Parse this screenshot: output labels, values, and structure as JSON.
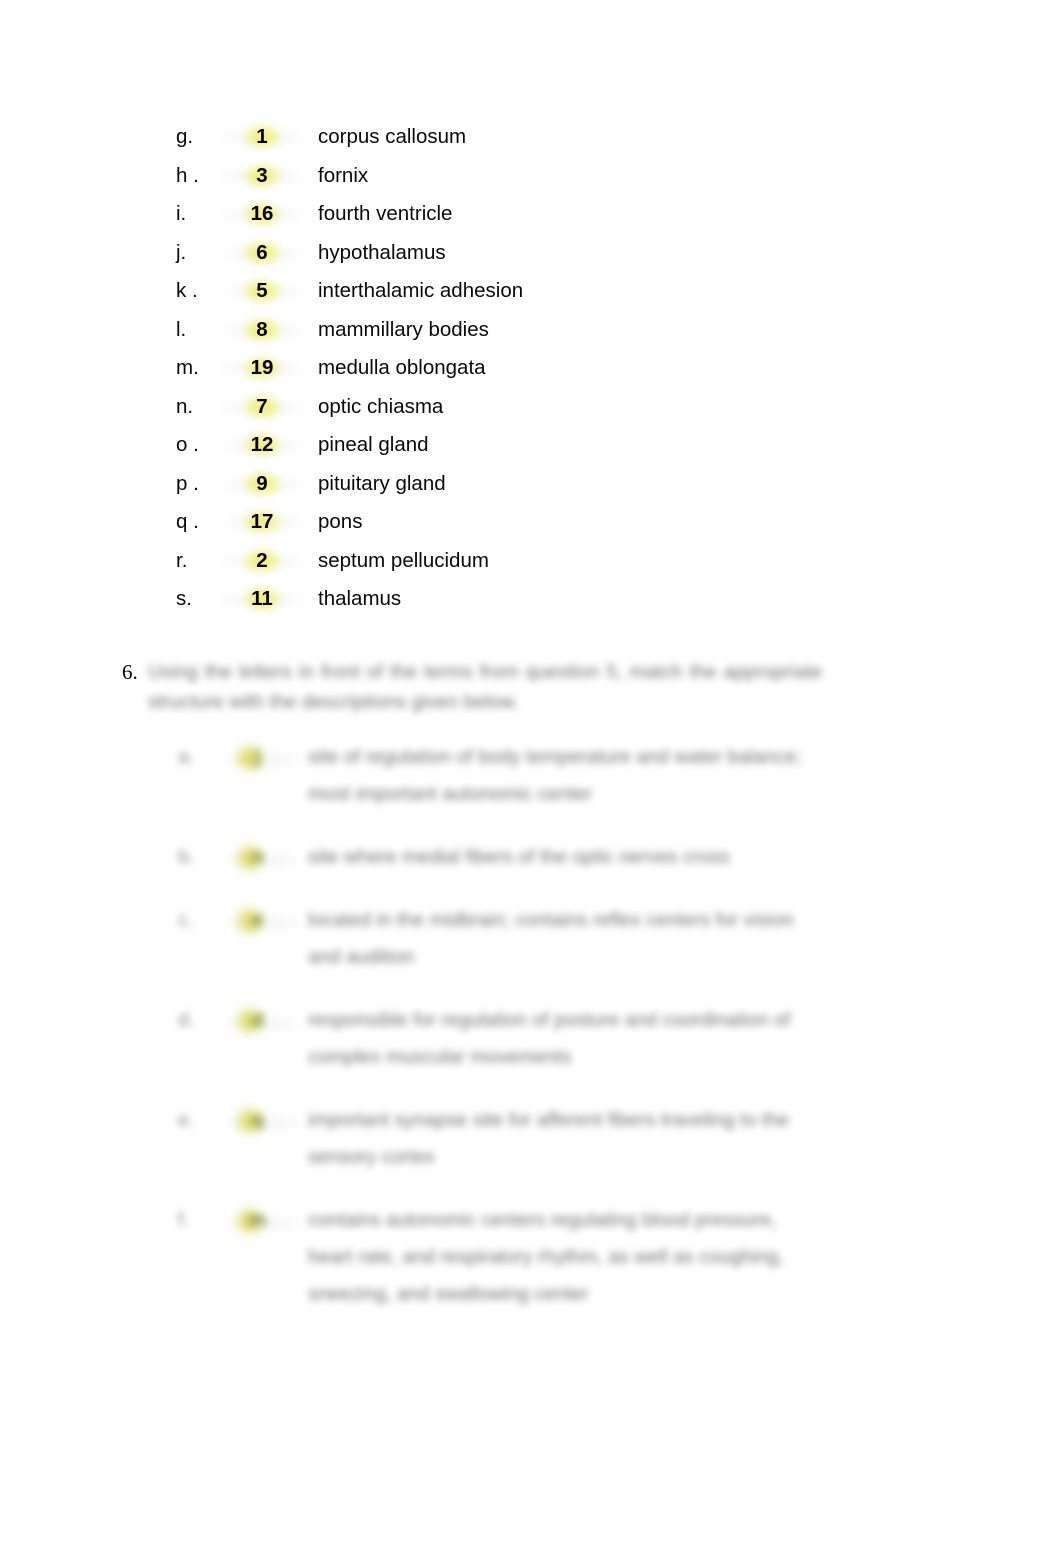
{
  "document": {
    "background_color": "#ffffff",
    "text_color": "#000000",
    "highlight_color": "#f0ee6e"
  },
  "matching_list": {
    "rows": [
      {
        "letter": "g.",
        "answer": "1",
        "term": "corpus callosum"
      },
      {
        "letter": "h .",
        "answer": "3",
        "term": "fornix"
      },
      {
        "letter": "i.",
        "answer": "16",
        "term": "fourth ventricle"
      },
      {
        "letter": "j.",
        "answer": "6",
        "term": "hypothalamus"
      },
      {
        "letter": "k .",
        "answer": "5",
        "term": "interthalamic adhesion"
      },
      {
        "letter": "l.",
        "answer": "8",
        "term": "mammillary bodies"
      },
      {
        "letter": "m.",
        "answer": "19",
        "term": "medulla oblongata"
      },
      {
        "letter": "n.",
        "answer": "7",
        "term": "optic chiasma"
      },
      {
        "letter": "o .",
        "answer": "12",
        "term": "pineal gland"
      },
      {
        "letter": "p .",
        "answer": "9",
        "term": "pituitary gland"
      },
      {
        "letter": "q .",
        "answer": "17",
        "term": "pons"
      },
      {
        "letter": "r.",
        "answer": "2",
        "term": "septum pellucidum"
      },
      {
        "letter": "s.",
        "answer": "11",
        "term": "thalamus"
      }
    ]
  },
  "question_6": {
    "number": "6.",
    "stem": "Using the letters in front of the terms from question 5, match the appropriate structure with the descriptions given below.",
    "items": [
      {
        "letter": "a.",
        "answer": "j",
        "description": "site of regulation of body temperature and water balance; most important autonomic center"
      },
      {
        "letter": "b.",
        "answer": "n",
        "description": "site where medial fibers of the optic nerves cross"
      },
      {
        "letter": "c.",
        "answer": "e",
        "description": "located in the midbrain; contains reflex centers for vision and audition"
      },
      {
        "letter": "d.",
        "answer": "d",
        "description": "responsible for regulation of posture and coordination of complex muscular movements"
      },
      {
        "letter": "e.",
        "answer": "q",
        "description": "important synapse site for afferent fibers traveling to the sensory cortex"
      },
      {
        "letter": "f.",
        "answer": "m",
        "description": "contains autonomic centers regulating blood pressure, heart rate, and respiratory rhythm, as well as coughing, sneezing, and swallowing center"
      }
    ]
  }
}
